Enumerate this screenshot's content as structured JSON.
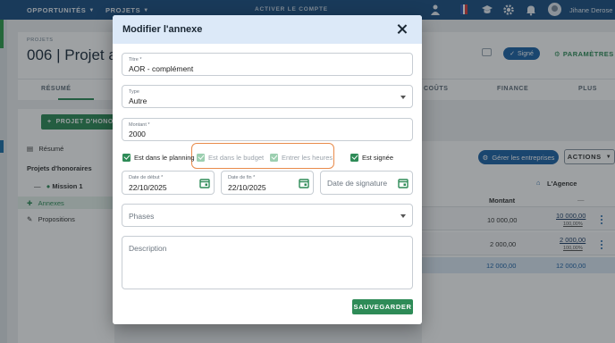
{
  "topbar": {
    "nav_opportunites": "OPPORTUNITÉS",
    "nav_projets": "PROJETS",
    "activate": "ACTIVER LE COMPTE",
    "username": "Jihane Derose",
    "icons": [
      "person-icon",
      "flag-fr-icon",
      "graduation-cap-icon",
      "gear-icon",
      "bell-icon",
      "avatar"
    ]
  },
  "project": {
    "small_label": "PROJETS",
    "title": "006 | Projet a",
    "status": "Signé",
    "params": "PARAMÈTRES"
  },
  "tabs": [
    "RÉSUMÉ",
    "COÛTS",
    "FINANCE",
    "PLUS"
  ],
  "sidebar": {
    "project_button": "PROJET D'HONO",
    "resume": "Résumé",
    "section": "Projets d'honoraires",
    "mission": "Mission 1",
    "annexes": "Annexes",
    "propositions": "Propositions"
  },
  "main": {
    "gerer": "Gérer les entreprises",
    "actions": "ACTIONS",
    "col_agence": "L'Agence",
    "col_montant": "Montant",
    "col_dash": "—",
    "rows": [
      {
        "montant": "10 000,00",
        "agence": "10 000,00",
        "pct": "100,00%"
      },
      {
        "montant": "2 000,00",
        "agence": "2 000,00",
        "pct": "100,00%"
      }
    ],
    "total_montant": "12 000,00",
    "total_agence": "12 000,00"
  },
  "modal": {
    "title": "Modifier l'annexe",
    "titre_label": "Titre *",
    "titre_value": "AOR - complément",
    "type_label": "Type",
    "type_value": "Autre",
    "montant_label": "Montant *",
    "montant_value": "2000",
    "checkboxes": {
      "planning": "Est dans le planning",
      "budget": "Est dans le budget",
      "heures": "Entrer les heures",
      "signee": "Est signée"
    },
    "date_debut_label": "Date de début *",
    "date_debut_value": "22/10/2025",
    "date_fin_label": "Date de fin *",
    "date_fin_value": "22/10/2025",
    "date_signature_ph": "Date de signature",
    "phases_ph": "Phases",
    "description_ph": "Description",
    "save": "SAUVEGARDER"
  },
  "colors": {
    "topbar": "#1b4f82",
    "primary_green": "#2e8b57",
    "primary_blue": "#1d62a6",
    "modal_header": "#dce9f8",
    "highlight_orange": "#e98b4b"
  }
}
